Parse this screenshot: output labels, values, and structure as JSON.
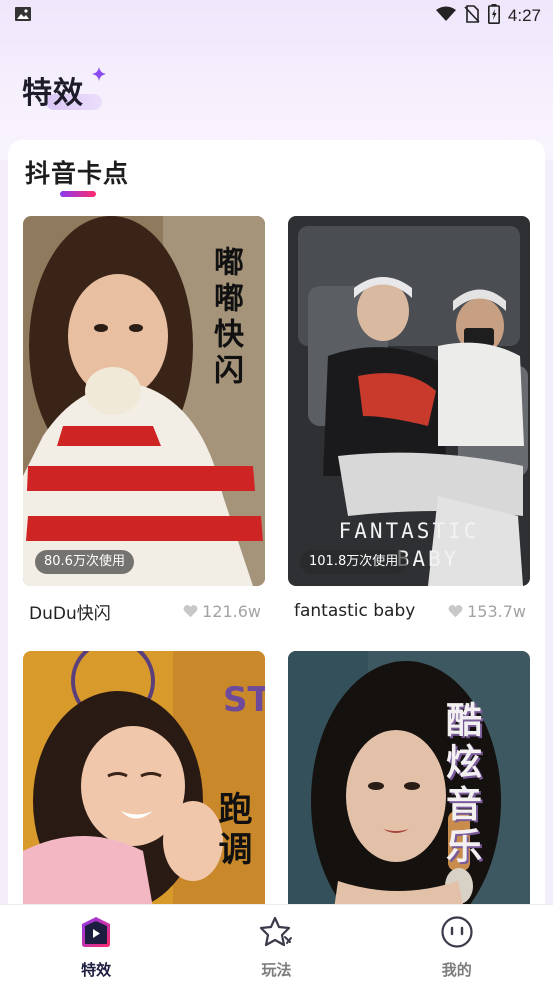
{
  "status_bar": {
    "time": "4:27",
    "icons": [
      "gallery-icon",
      "wifi-icon",
      "no-sim-icon",
      "battery-icon"
    ]
  },
  "header": {
    "title": "特效"
  },
  "section": {
    "title": "抖音卡点"
  },
  "cards": [
    {
      "name": "DuDu快闪",
      "usage": "80.6万次使用",
      "likes": "121.6w",
      "overlay_text": "嘟嘟快闪"
    },
    {
      "name": "fantastic baby",
      "usage": "101.8万次使用",
      "likes": "153.7w",
      "overlay_text_line1": "FANTASTIC",
      "overlay_text_line2": "BABY"
    },
    {
      "overlay_text": "跑调"
    },
    {
      "overlay_text": "酷炫音乐"
    }
  ],
  "bottom_nav": {
    "items": [
      {
        "label": "特效",
        "icon": "play-icon",
        "active": true
      },
      {
        "label": "玩法",
        "icon": "star-icon",
        "active": false
      },
      {
        "label": "我的",
        "icon": "face-icon",
        "active": false
      }
    ]
  },
  "colors": {
    "accent_start": "#8a3bf0",
    "accent_end": "#ff2a6a",
    "like_gray": "#a3a3a3",
    "nav_active": "#1d1d40"
  }
}
